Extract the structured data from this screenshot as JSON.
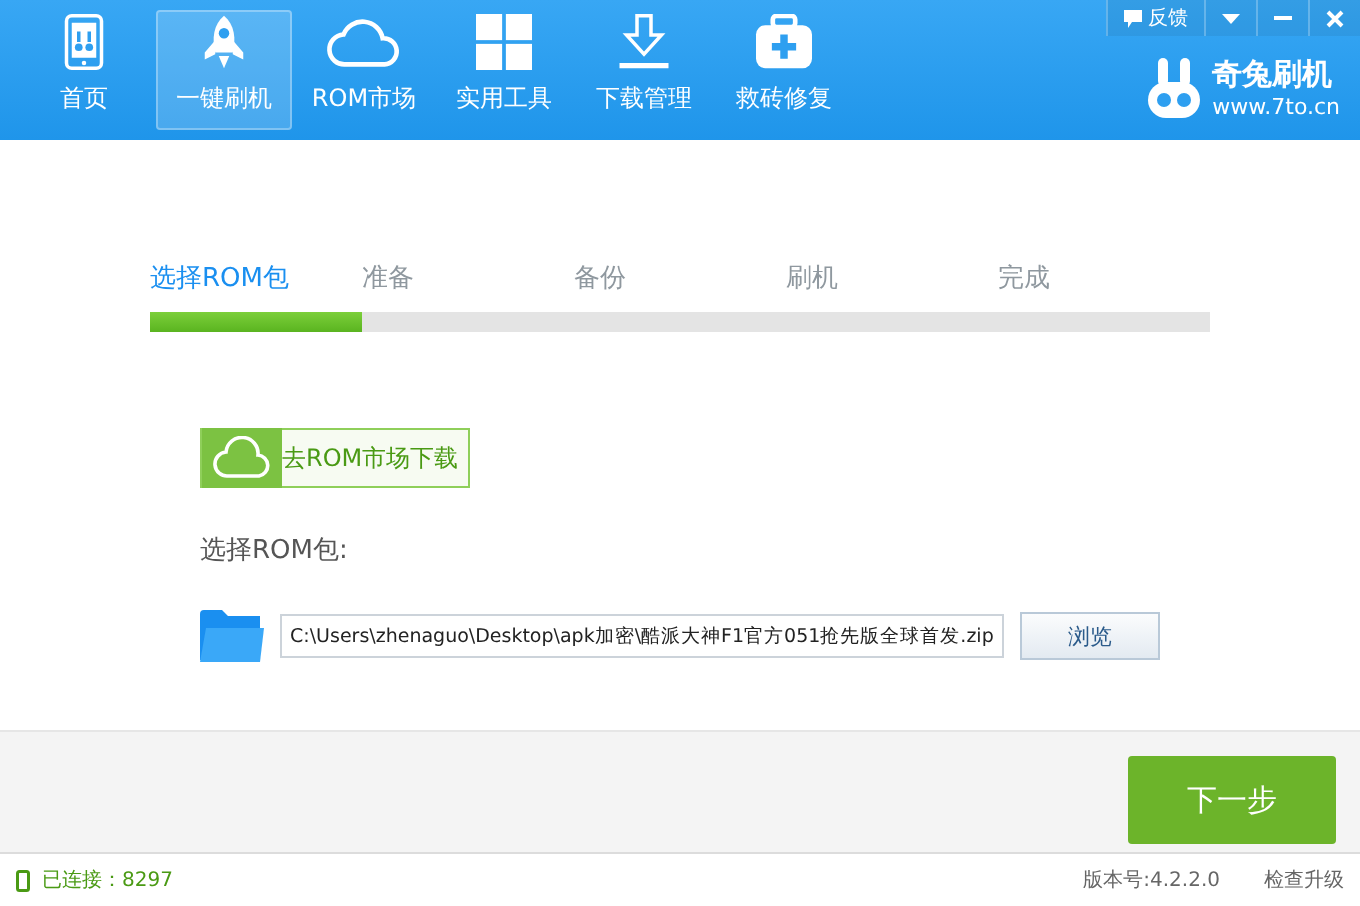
{
  "window_controls": {
    "feedback": "反馈"
  },
  "nav": [
    {
      "label": "首页",
      "kind": "phone",
      "selected": false
    },
    {
      "label": "一键刷机",
      "kind": "rocket",
      "selected": true
    },
    {
      "label": "ROM市场",
      "kind": "cloud",
      "selected": false
    },
    {
      "label": "实用工具",
      "kind": "grid",
      "selected": false
    },
    {
      "label": "下载管理",
      "kind": "download",
      "selected": false
    },
    {
      "label": "救砖修复",
      "kind": "kit",
      "selected": false
    }
  ],
  "logo": {
    "name": "奇兔刷机",
    "url": "www.7to.cn"
  },
  "steps": [
    {
      "label": "选择ROM包",
      "selected": true
    },
    {
      "label": "准备",
      "selected": false
    },
    {
      "label": "备份",
      "selected": false
    },
    {
      "label": "刷机",
      "selected": false
    },
    {
      "label": "完成",
      "selected": false
    }
  ],
  "progress": {
    "level": 0.2
  },
  "market_button": "去ROM市场下载",
  "rom_label": "选择ROM包:",
  "file_path": "C:\\Users\\zhenaguo\\Desktop\\apk加密\\酷派大神F1官方051抢先版全球首发.zip",
  "browse_button": "浏览",
  "next_button": "下一步",
  "status_bar": {
    "connection": "已连接：8297",
    "version": "版本号:4.2.2.0",
    "update": "检查升级"
  }
}
